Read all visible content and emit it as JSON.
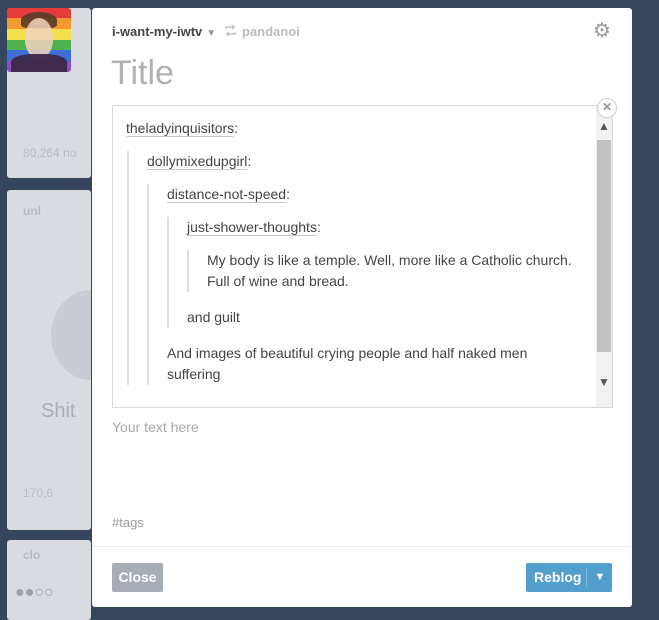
{
  "header": {
    "blog_name": "i-want-my-iwtv",
    "reblog_source": "pandanoi"
  },
  "title_placeholder": "Title",
  "quote_chain": {
    "user1": "theladyinquisitors",
    "user2": "dollymixedupgirl",
    "user3": "distance-not-speed",
    "user4": "just-shower-thoughts",
    "line_a": "My body is like a temple. Well, more like a Catholic church.",
    "line_b": "Full of wine and bread.",
    "reply1": "and guilt",
    "reply2_a": "And images of beautiful crying people and half naked men",
    "reply2_b": "suffering"
  },
  "body_placeholder": "Your text here",
  "tags_placeholder": "#tags",
  "buttons": {
    "close": "Close",
    "reblog": "Reblog"
  },
  "colors": {
    "accent": "#529ecc",
    "close_button": "#a6adb5",
    "backdrop": "#36465d"
  },
  "icons": [
    "reblog-icon",
    "gear-icon",
    "close-icon",
    "chevron-down-icon",
    "scroll-up-icon",
    "scroll-down-icon"
  ]
}
